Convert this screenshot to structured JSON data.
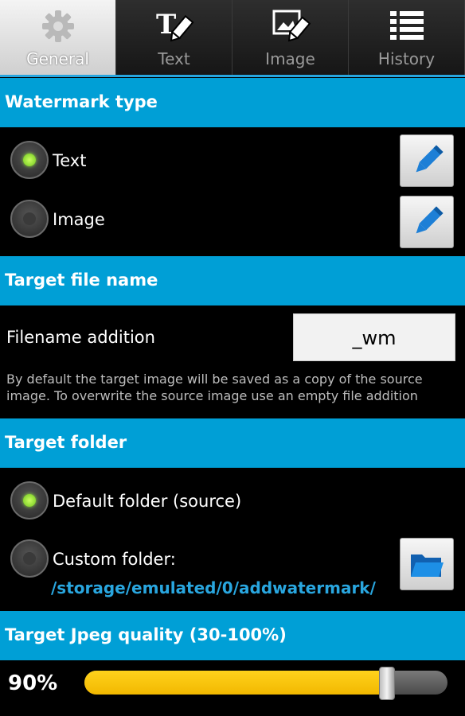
{
  "tabs": [
    {
      "label": "General",
      "icon": "gear-icon",
      "selected": true
    },
    {
      "label": "Text",
      "icon": "text-edit-icon",
      "selected": false
    },
    {
      "label": "Image",
      "icon": "image-edit-icon",
      "selected": false
    },
    {
      "label": "History",
      "icon": "list-icon",
      "selected": false
    }
  ],
  "sections": {
    "watermark_type": "Watermark type",
    "target_file_name": "Target file name",
    "target_folder": "Target folder",
    "jpeg_quality": "Target Jpeg quality (30-100%)"
  },
  "watermark_type": {
    "text_label": "Text",
    "image_label": "Image",
    "selected": "text",
    "edit_icon": "pencil-icon"
  },
  "filename": {
    "label": "Filename addition",
    "value": "_wm",
    "hint": "By default the target image will be saved as a copy of the source image. To overwrite the source image use an empty file addition"
  },
  "folder": {
    "default_label": "Default folder (source)",
    "custom_label": "Custom folder:",
    "custom_path": "/storage/emulated/0/addwatermark/",
    "selected": "default",
    "folder_icon": "folder-open-icon"
  },
  "quality": {
    "value_label": "90%",
    "value": 90,
    "min": 30,
    "max": 100
  },
  "colors": {
    "accent": "#009fd6",
    "slider_fill": "#ffc300",
    "radio_checked": "#8fe33b",
    "path_text": "#29a6df"
  }
}
